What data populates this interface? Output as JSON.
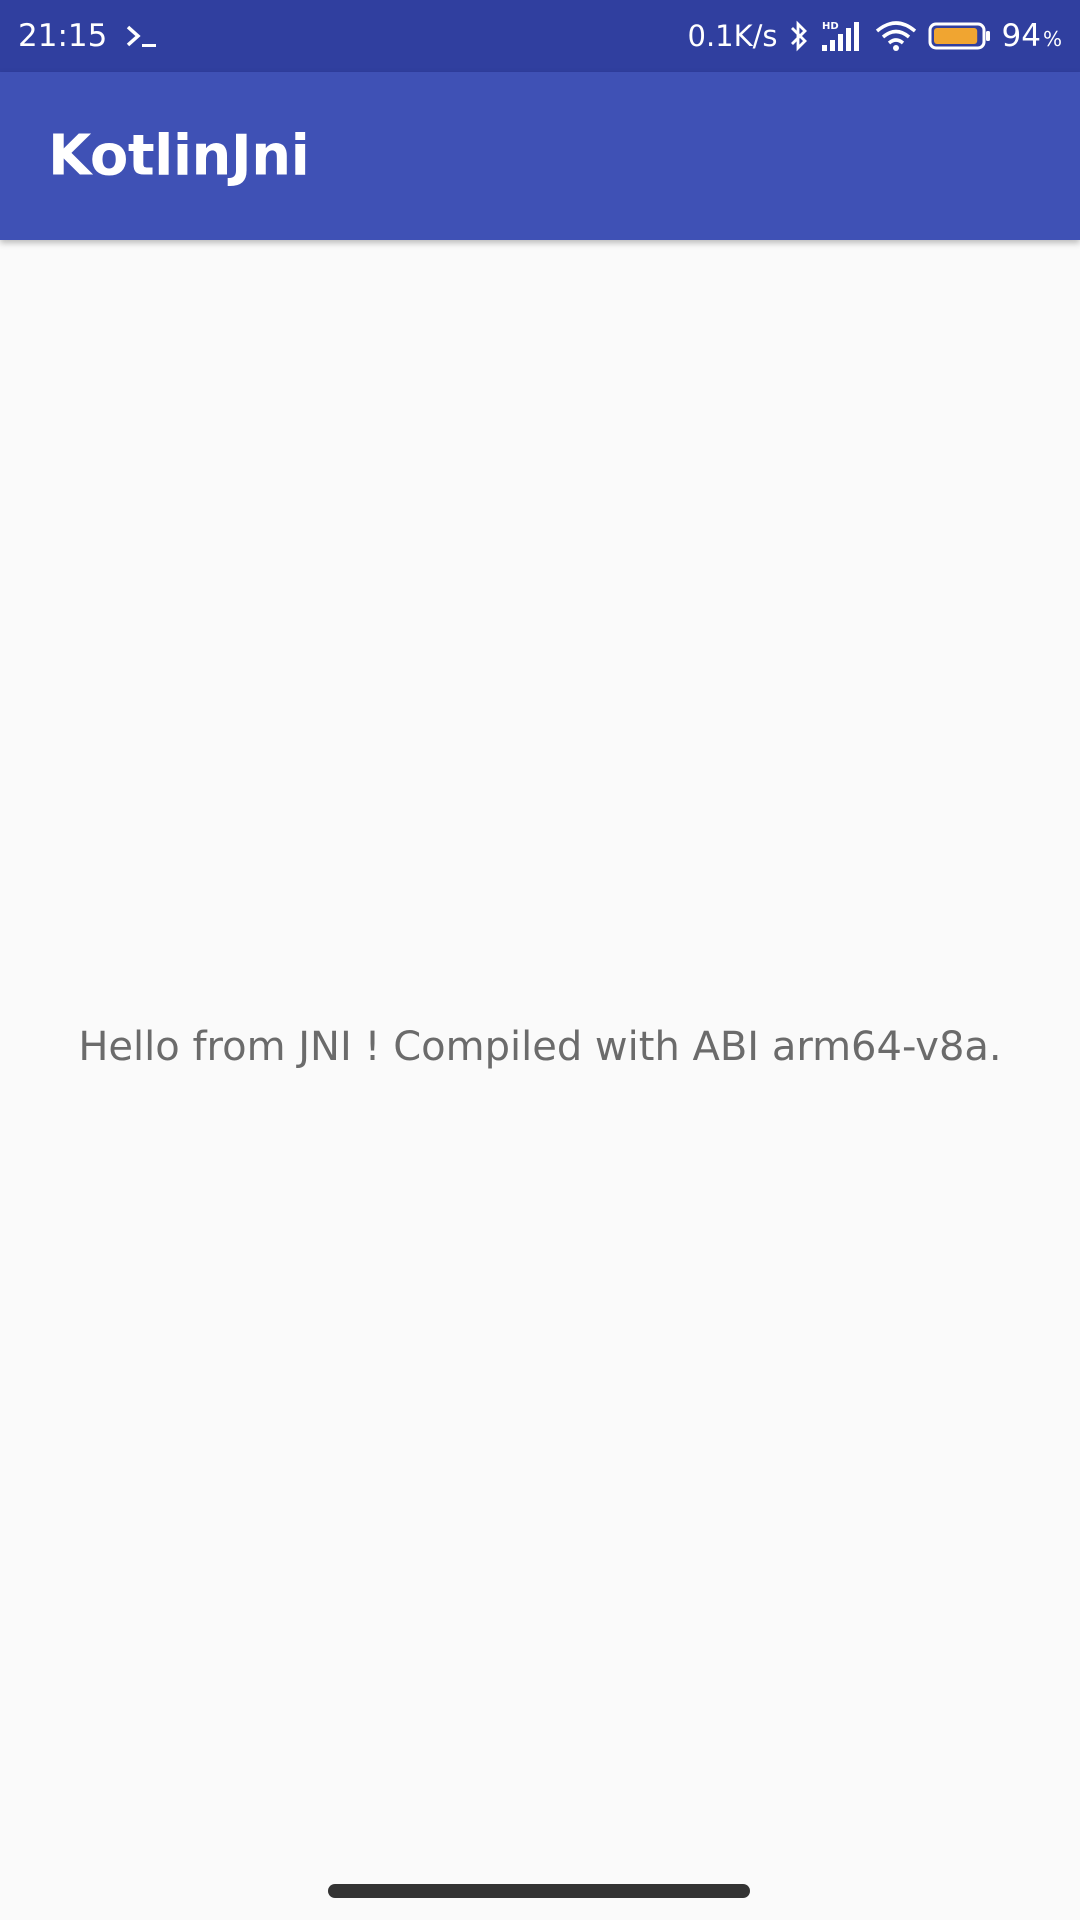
{
  "status_bar": {
    "time": "21:15",
    "terminal_icon": "terminal-prompt-icon",
    "net_speed": "0.1K/s",
    "bluetooth_icon": "bluetooth-icon",
    "signal_icon": "hd-signal-icon",
    "wifi_icon": "wifi-icon",
    "battery_icon": "battery-icon",
    "battery_level": 0.94,
    "battery_percent": "94",
    "battery_percent_unit": "%",
    "battery_color": "#f0a531"
  },
  "app_bar": {
    "title": "KotlinJni",
    "color": "#3f51b5"
  },
  "main": {
    "message": "Hello from JNI !  Compiled with ABI arm64-v8a."
  }
}
